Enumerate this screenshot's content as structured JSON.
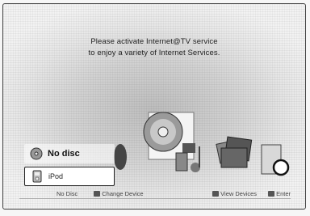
{
  "message": {
    "line1": "Please activate Internet@TV service",
    "line2": "to enjoy a variety of Internet Services."
  },
  "menu": {
    "items": [
      {
        "label": "No disc",
        "icon": "disc-icon"
      },
      {
        "label": "iPod",
        "icon": "ipod-icon"
      }
    ]
  },
  "hints": {
    "no_disc": "No Disc",
    "change_device": "Change Device",
    "view_devices": "View Devices",
    "enter": "Enter"
  }
}
